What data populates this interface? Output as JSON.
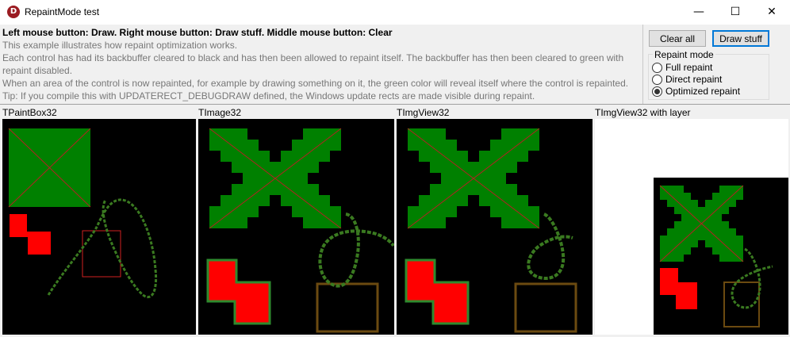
{
  "window": {
    "title": "RepaintMode test",
    "icon_letter": "D",
    "controls": [
      "minimize-icon",
      "maximize-icon",
      "close-icon"
    ]
  },
  "info": {
    "heading": "Left mouse button: Draw. Right mouse button: Draw stuff. Middle mouse button: Clear",
    "lines": [
      "This example illustrates how repaint optimization works.",
      "Each control has had its backbuffer cleared to black and has then been allowed to repaint itself. The backbuffer has then been cleared to green with",
      "repaint disabled.",
      "When an area of the control is now repainted, for example by drawing something on it, the green color will reveal itself where the control is repainted.",
      "Tip: If you compile this with UPDATERECT_DEBUGDRAW defined, the Windows update rects are made visible during repaint."
    ]
  },
  "buttons": {
    "clear_all": "Clear all",
    "draw_stuff": "Draw stuff"
  },
  "repaint_mode": {
    "title": "Repaint mode",
    "options": [
      {
        "label": "Full repaint",
        "selected": false
      },
      {
        "label": "Direct repaint",
        "selected": false
      },
      {
        "label": "Optimized repaint",
        "selected": true
      }
    ]
  },
  "panels": [
    {
      "label": "TPaintBox32"
    },
    {
      "label": "TImage32"
    },
    {
      "label": "TImgView32"
    },
    {
      "label": "TImgView32 with layer"
    }
  ],
  "colors": {
    "green_fill": "#008000",
    "red_fill": "#ff0000",
    "line": "#b22222",
    "stroke_green": "#2e8b2e"
  }
}
